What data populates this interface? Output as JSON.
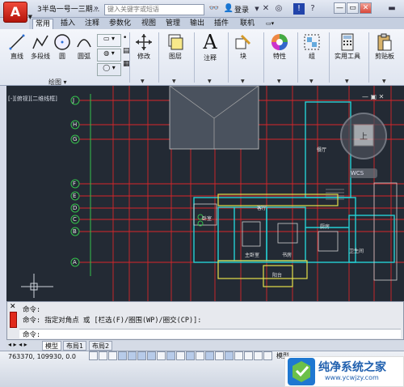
{
  "titlebar": {
    "doc_title": "3半岛一号一三期...",
    "search_placeholder": "键入关键字或短语",
    "login_label": "登录",
    "minimize": "—",
    "restore": "▭",
    "close": "✕"
  },
  "ribbon": {
    "tabs": [
      {
        "label": "常用",
        "active": true
      },
      {
        "label": "插入",
        "active": false
      },
      {
        "label": "注释",
        "active": false
      },
      {
        "label": "参数化",
        "active": false
      },
      {
        "label": "视图",
        "active": false
      },
      {
        "label": "管理",
        "active": false
      },
      {
        "label": "输出",
        "active": false
      },
      {
        "label": "插件",
        "active": false
      },
      {
        "label": "联机",
        "active": false
      }
    ],
    "draw_tools": [
      "直线",
      "多段线",
      "圆",
      "圆弧"
    ],
    "draw_panel_label": "绘图 ▾",
    "groups": [
      "修改",
      "图层",
      "注释",
      "块",
      "特性",
      "组",
      "实用工具",
      "剪贴板"
    ]
  },
  "viewport": {
    "label": "[-][俯视][二维线框]",
    "wcs": "WCS",
    "axis_rows": [
      "J",
      "H",
      "G",
      "F",
      "E",
      "D",
      "C",
      "B",
      "A"
    ],
    "rooms": [
      "卧室",
      "客厅",
      "主卧室",
      "书房",
      "厨房",
      "卫生间",
      "阳台",
      "餐厅"
    ]
  },
  "command": {
    "history_1": "命令:",
    "history_2": "命令: 指定对角点 或 [栏选(F)/圈围(WP)/圈交(CP)]:",
    "prompt": "命令:"
  },
  "layout_tabs": [
    {
      "label": "模型",
      "active": true
    },
    {
      "label": "布局1",
      "active": false
    },
    {
      "label": "布局2",
      "active": false
    }
  ],
  "status": {
    "coords": "763370, 109930, 0.0",
    "model": "模型"
  },
  "watermark": {
    "title": "纯净系统之家",
    "url": "www.ycwjzy.com"
  },
  "colors": {
    "canvas_bg": "#232a34",
    "grid_red": "#d8252a",
    "wall_cyan": "#25d0d4",
    "axis_green": "#34c04b",
    "yellow": "#e6e04a",
    "accent_red": "#e02a1c"
  }
}
